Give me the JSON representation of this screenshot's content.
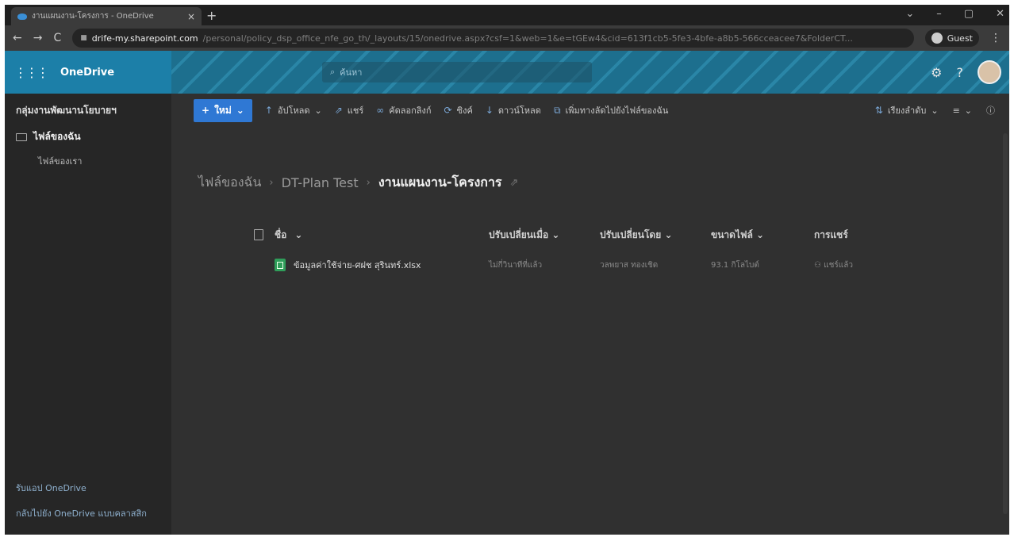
{
  "browser": {
    "tab_title": "งานแผนงาน-โครงการ - OneDrive",
    "tab_close": "×",
    "new_tab": "+",
    "window_controls": {
      "minimize": "–",
      "maximize": "▢",
      "close": "✕",
      "tabs_menu": "⌄"
    },
    "back": "←",
    "forward": "→",
    "reload": "C",
    "url_host": "drife-my.sharepoint.com",
    "url_path": "/personal/policy_dsp_office_nfe_go_th/_layouts/15/onedrive.aspx?csf=1&web=1&e=tGEw4&cid=613f1cb5-5fe3-4bfe-a8b5-566cceacee7&FolderCT...",
    "guest_label": "Guest",
    "menu": "⋮"
  },
  "suite": {
    "app_name": "OneDrive",
    "search_placeholder": "ค้นหา",
    "settings_icon": "⚙",
    "help_icon": "?"
  },
  "sidebar": {
    "site_name": "กลุ่มงานพัฒนานโยบายฯ",
    "items": [
      {
        "label": "ไฟล์ของฉัน",
        "active": true
      },
      {
        "label": "ไฟล์ของเรา",
        "active": false
      }
    ],
    "footer_buy": "รับแอป OneDrive",
    "footer_back": "กลับไปยัง OneDrive แบบคลาสสิก"
  },
  "commandbar": {
    "new": "ใหม่",
    "upload": "อัปโหลด",
    "share": "แชร์",
    "copy_link": "คัดลอกลิงก์",
    "sync": "ซิงค์",
    "download": "ดาวน์โหลด",
    "add_shortcut": "เพิ่มทางลัดไปยังไฟล์ของฉัน",
    "sort": "เรียงลำดับ",
    "info_icon": "ⓘ"
  },
  "breadcrumb": {
    "items": [
      "ไฟล์ของฉัน",
      "DT-Plan Test",
      "งานแผนงาน-โครงการ"
    ],
    "separator": "›",
    "share_icon": "⇗"
  },
  "table": {
    "headers": {
      "name": "ชื่อ",
      "modified": "ปรับเปลี่ยนเมื่อ",
      "modified_by": "ปรับเปลี่ยนโดย",
      "size": "ขนาดไฟล์",
      "sharing": "การแชร์"
    },
    "rows": [
      {
        "name": "ข้อมูลค่าใช้จ่าย-ศฝช สุรินทร์.xlsx",
        "modified": "ไม่กี่วินาทีที่แล้ว",
        "modified_by": "วลพยาส ทองเชิด",
        "size": "93.1 กิโลไบต์",
        "sharing": "แชร์แล้ว"
      }
    ]
  },
  "colors": {
    "accent": "#2f78d4",
    "suite_bar": "#1c7fa8",
    "background": "#303030"
  }
}
